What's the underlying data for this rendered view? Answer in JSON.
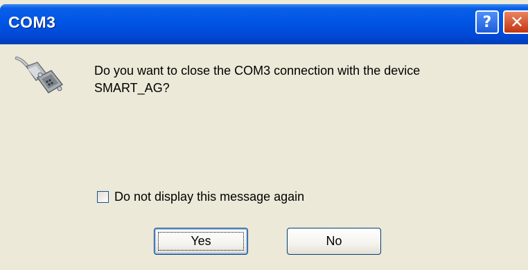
{
  "window": {
    "title": "COM3",
    "help_glyph": "?",
    "close_glyph": "✕"
  },
  "dialog": {
    "icon": "serial-cable-icon",
    "message_line1": "Do you want to close the COM3 connection with the device",
    "message_line2": "SMART_AG?",
    "checkbox_label": "Do not display this message again",
    "checkbox_checked": false,
    "yes_label": "Yes",
    "no_label": "No"
  },
  "colors": {
    "titlebar": "#0055E5",
    "dialog_bg": "#ECE9D8",
    "close_button": "#C33412"
  }
}
